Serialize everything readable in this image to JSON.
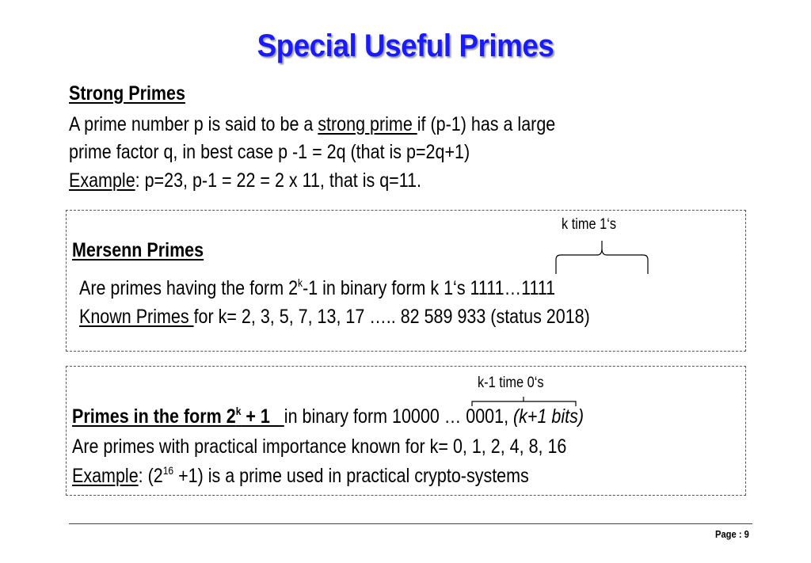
{
  "title": "Special Useful Primes",
  "strong": {
    "heading": "Strong Primes",
    "line1_a": "A prime number p is said to be a ",
    "line1_link": "strong prime ",
    "line1_b": "if (p-1)  has a large",
    "line2": "prime factor q,  in best case  p -1 = 2q    (that is p=2q+1)",
    "line3_label": "Example",
    "line3_rest": ":   p=23,   p-1 = 22 = 2 x 11,  that is q=11."
  },
  "mersenne": {
    "heading": "Mersenn Primes",
    "annotation": "k time 1‘s",
    "line1_a": "Are primes having the form  2",
    "line1_sup": "k",
    "line1_b": "-1   in binary form k 1‘s  1111…1111",
    "line2_label": "Known Primes ",
    "line2_rest": "for k= 2, 3, 5, 7, 13, 17 ….. 82 589 933 (status 2018)"
  },
  "fermat": {
    "annotation": "k-1 time 0‘s",
    "heading_a": "Primes in the form  2",
    "heading_sup": "k",
    "heading_b": " + 1   ",
    "line1_rest": "in binary form  10000 … 0001, ",
    "line1_italic": "(k+1 bits)",
    "line2": "Are primes with practical importance known for k= 0, 1, 2, 4, 8, 16",
    "line3_label": "Example",
    "line3_a": ": (2",
    "line3_sup": "16",
    "line3_b": " +1) is a prime used in practical crypto-systems"
  },
  "footer": {
    "page_label": "Page :  9"
  }
}
